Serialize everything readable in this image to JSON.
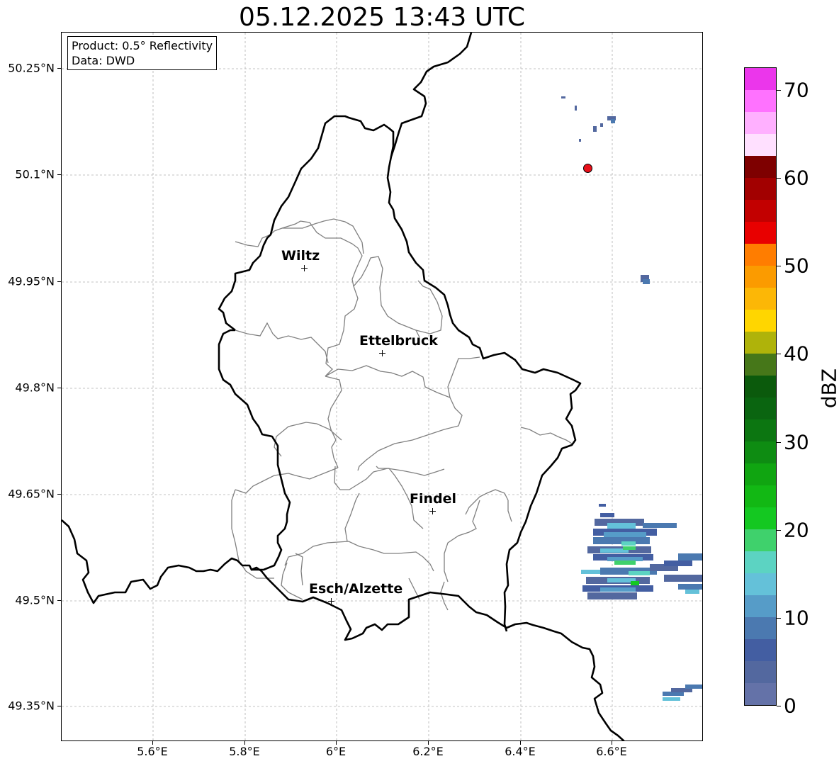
{
  "title": "05.12.2025 13:43 UTC",
  "info": {
    "product": "Product: 0.5° Reflectivity",
    "data_source": "Data: DWD"
  },
  "axes": {
    "lat_ticks": [
      "50.25°N",
      "50.1°N",
      "49.95°N",
      "49.8°N",
      "49.65°N",
      "49.5°N",
      "49.35°N"
    ],
    "lon_ticks": [
      "5.6°E",
      "5.8°E",
      "6°E",
      "6.2°E",
      "6.4°E",
      "6.6°E"
    ]
  },
  "cities": [
    {
      "name": "Wiltz"
    },
    {
      "name": "Ettelbruck"
    },
    {
      "name": "Findel"
    },
    {
      "name": "Esch/Alzette"
    }
  ],
  "colorbar": {
    "label": "dBZ",
    "ticks": [
      "0",
      "10",
      "20",
      "30",
      "40",
      "50",
      "60",
      "70"
    ],
    "colors": [
      "#6472a8",
      "#53689f",
      "#435ea2",
      "#4b79b0",
      "#569cc8",
      "#64c1d9",
      "#5cd3c2",
      "#3fd16c",
      "#14c821",
      "#12b814",
      "#10a511",
      "#0e8c12",
      "#0c7611",
      "#0a6510",
      "#0b5a0c",
      "#467719",
      "#afb30a",
      "#ffd600",
      "#fcb706",
      "#fb9b00",
      "#ff7d00",
      "#e80000",
      "#c20000",
      "#a20000",
      "#7e0000",
      "#ffe0ff",
      "#ffb0ff",
      "#ff72ff",
      "#eb36eb"
    ],
    "min": 0,
    "max": 72.5
  },
  "map_colors": {
    "border": "#000000",
    "canton_lines": "#808080",
    "grid": "#b0b0b0",
    "radar_site": "#e8101a"
  },
  "icons": {
    "city_marker": "plus-marker-icon",
    "radar_site": "red-dot-icon"
  }
}
